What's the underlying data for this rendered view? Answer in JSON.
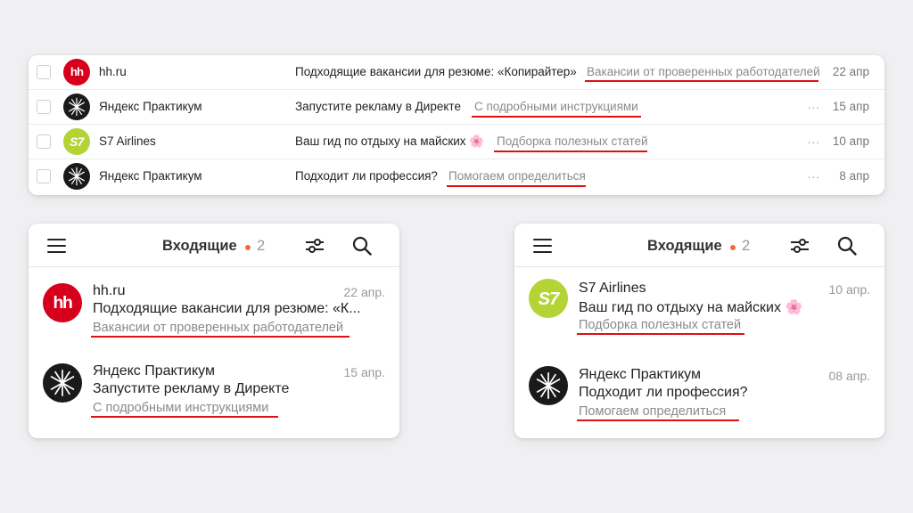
{
  "desktop_list": {
    "rows": [
      {
        "sender": "hh.ru",
        "avatar": "hh-logo-icon",
        "subject": "Подходящие вакансии для резюме: «Копирайтер»",
        "preview": "Вакансии от проверенных работодателей",
        "date": "22 апр",
        "dots": ""
      },
      {
        "sender": "Яндекс Практикум",
        "avatar": "praktikum-logo-icon",
        "subject": "Запустите рекламу в Директе",
        "preview": "С подробными инструкциями",
        "date": "15 апр",
        "dots": "..."
      },
      {
        "sender": "S7 Airlines",
        "avatar": "s7-logo-icon",
        "subject": "Ваш гид по отдыху на майских 🌸",
        "preview": "Подборка полезных статей",
        "date": "10 апр",
        "dots": "..."
      },
      {
        "sender": "Яндекс Практикум",
        "avatar": "praktikum-logo-icon",
        "subject": "Подходит ли профессия?",
        "preview": "Помогаем определиться",
        "date": "8 апр",
        "dots": "..."
      }
    ]
  },
  "mobile_left": {
    "header": {
      "title": "Входящие",
      "count": "2"
    },
    "items": [
      {
        "sender": "hh.ru",
        "avatar": "hh-logo-icon",
        "subject": "Подходящие вакансии для резюме: «К...",
        "preview": "Вакансии от проверенных работодателей",
        "date": "22 апр."
      },
      {
        "sender": "Яндекс Практикум",
        "avatar": "praktikum-logo-icon",
        "subject": "Запустите рекламу в Директе",
        "preview": "С подробными инструкциями",
        "date": "15 апр."
      }
    ]
  },
  "mobile_right": {
    "header": {
      "title": "Входящие",
      "count": "2"
    },
    "items": [
      {
        "sender": "S7 Airlines",
        "avatar": "s7-logo-icon",
        "subject": "Ваш гид по отдыху на майских 🌸",
        "preview": "Подборка полезных статей",
        "date": "10 апр."
      },
      {
        "sender": "Яндекс Практикум",
        "avatar": "praktikum-logo-icon",
        "subject": "Подходит ли профессия?",
        "preview": "Помогаем определиться",
        "date": "08 апр."
      }
    ]
  },
  "colors": {
    "hh_red": "#d6001c",
    "s7_green": "#b4d334",
    "praktikum_black": "#1a1a1a",
    "underline_red": "#e01010",
    "unread_dot": "#f06a3a"
  },
  "icons": [
    "menu-icon",
    "filter-icon",
    "search-icon",
    "checkbox",
    "hh-logo-icon",
    "praktikum-logo-icon",
    "s7-logo-icon"
  ]
}
